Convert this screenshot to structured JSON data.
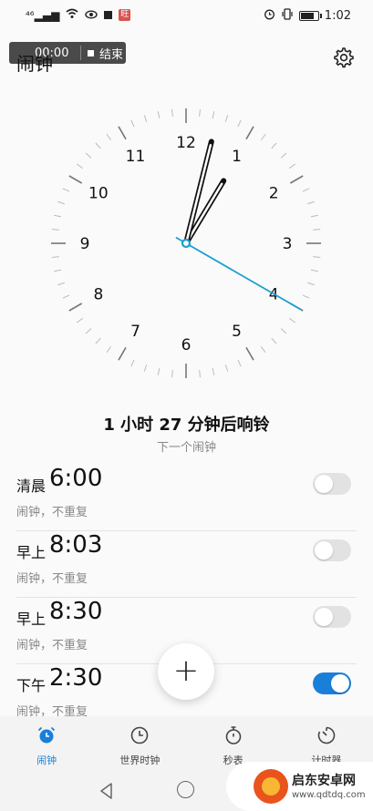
{
  "status_bar": {
    "network": "⁴⁶",
    "red_badge": "旺",
    "time": "1:02",
    "battery_level": 0.8
  },
  "recording": {
    "elapsed": "00:00",
    "stop_label": "结束"
  },
  "header": {
    "title": "闹钟"
  },
  "clock": {
    "numbers": [
      "12",
      "1",
      "2",
      "3",
      "4",
      "5",
      "6",
      "7",
      "8",
      "9",
      "10",
      "11"
    ],
    "hour": 1,
    "minute": 2,
    "second": 20
  },
  "next_alarm": {
    "text": "1 小时 27 分钟后响铃",
    "subtitle": "下一个闹钟"
  },
  "alarms": [
    {
      "period": "清晨",
      "time": "6:00",
      "desc": "闹钟，不重复",
      "enabled": false
    },
    {
      "period": "早上",
      "time": "8:03",
      "desc": "闹钟，不重复",
      "enabled": false
    },
    {
      "period": "早上",
      "time": "8:30",
      "desc": "闹钟，不重复",
      "enabled": false
    },
    {
      "period": "下午",
      "time": "2:30",
      "desc": "闹钟，不重复",
      "enabled": true
    }
  ],
  "fab": {
    "label": "+"
  },
  "tabs": [
    {
      "label": "闹钟",
      "icon": "alarm-clock-icon",
      "active": true
    },
    {
      "label": "世界时钟",
      "icon": "world-clock-icon",
      "active": false
    },
    {
      "label": "秒表",
      "icon": "stopwatch-icon",
      "active": false
    },
    {
      "label": "计时器",
      "icon": "timer-icon",
      "active": false
    }
  ],
  "watermark": {
    "title": "启东安卓网",
    "url": "www.qdtdq.com"
  },
  "colors": {
    "accent": "#1a7fd9",
    "second_hand": "#1a9fd0"
  }
}
